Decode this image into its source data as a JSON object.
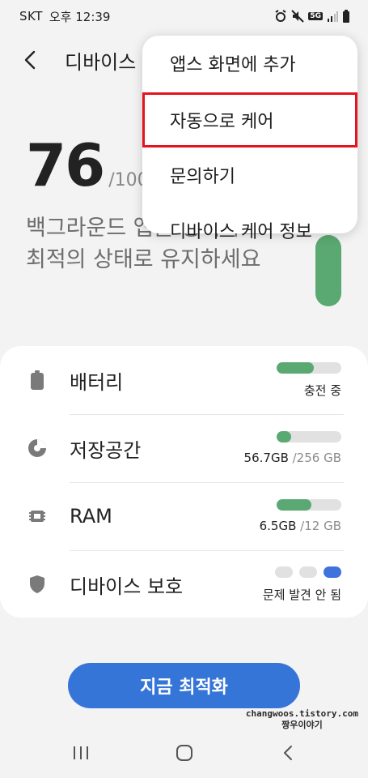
{
  "status_bar": {
    "carrier": "SKT",
    "time": "오후 12:39",
    "network_badge": "5G"
  },
  "header": {
    "title": "디바이스 케어"
  },
  "score": {
    "value": "76",
    "max": "/100",
    "description": "백그라운드 앱을 정리하고 최적의 상태로 유지하세요"
  },
  "items": [
    {
      "label": "배터리",
      "icon": "battery-icon",
      "fill": 0.58,
      "sub_value": "충전 중",
      "sub_unit": ""
    },
    {
      "label": "저장공간",
      "icon": "storage-pie-icon",
      "fill": 0.22,
      "sub_value": "56.7GB",
      "sub_unit": " /256 GB"
    },
    {
      "label": "RAM",
      "icon": "chip-icon",
      "fill": 0.54,
      "sub_value": "6.5GB",
      "sub_unit": " /12 GB"
    },
    {
      "label": "디바이스 보호",
      "icon": "shield-icon",
      "sub_value": "문제 발견 안 됨",
      "sub_unit": ""
    }
  ],
  "optimize_button": "지금 최적화",
  "menu": {
    "items": [
      "앱스 화면에 추가",
      "자동으로 케어",
      "문의하기",
      "디바이스 케어 정보"
    ],
    "highlighted_index": 1
  },
  "watermark": {
    "line1": "changwoos.tistory.com",
    "line2": "짱우이야기"
  },
  "colors": {
    "accent_green": "#5aa872",
    "button_blue": "#3575d8",
    "highlight_red": "#e3141b"
  }
}
